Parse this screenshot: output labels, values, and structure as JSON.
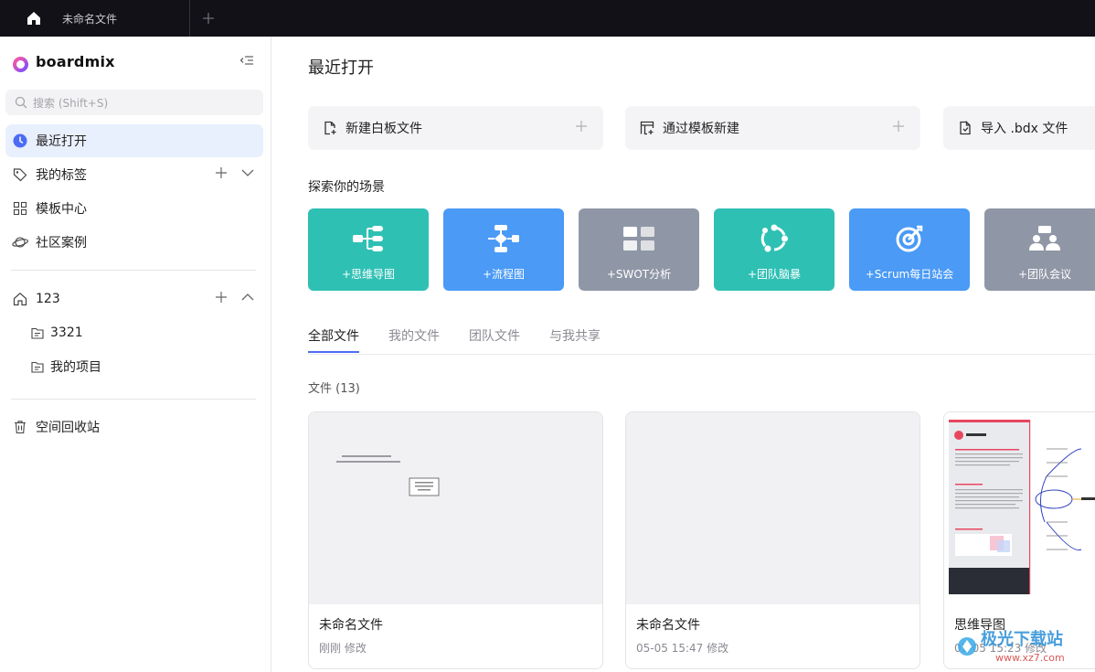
{
  "topbar": {
    "home_icon": "home-icon",
    "doc_tab_label": "未命名文件",
    "new_tab_icon": "plus-icon"
  },
  "sidebar": {
    "brand": "boardmix",
    "search_placeholder": "搜索 (Shift+S)",
    "nav": [
      {
        "label": "最近打开",
        "icon": "clock-icon",
        "active": true
      },
      {
        "label": "我的标签",
        "icon": "tag-icon"
      },
      {
        "label": "模板中心",
        "icon": "grid-icon"
      },
      {
        "label": "社区案例",
        "icon": "planet-icon"
      }
    ],
    "space": {
      "label": "123",
      "icon": "home-outline-icon"
    },
    "folders": [
      {
        "label": "3321",
        "icon": "folder-icon"
      },
      {
        "label": "我的项目",
        "icon": "folder-icon"
      }
    ],
    "trash": {
      "label": "空间回收站",
      "icon": "trash-icon"
    }
  },
  "main": {
    "title": "最近打开",
    "quick_actions": [
      {
        "label": "新建白板文件",
        "icon": "new-file-icon"
      },
      {
        "label": "通过模板新建",
        "icon": "template-icon"
      },
      {
        "label": "导入 .bdx 文件",
        "icon": "import-icon"
      }
    ],
    "scenes_label": "探索你的场景",
    "scenes": [
      {
        "label": "+思维导图",
        "color": "#2fc0b4",
        "icon": "mindmap-icon"
      },
      {
        "label": "+流程图",
        "color": "#4a9af6",
        "icon": "flowchart-icon"
      },
      {
        "label": "+SWOT分析",
        "color": "#8f97a6",
        "icon": "swot-icon"
      },
      {
        "label": "+团队脑暴",
        "color": "#2fc0b4",
        "icon": "brainstorm-icon"
      },
      {
        "label": "+Scrum每日站会",
        "color": "#4a9af6",
        "icon": "target-icon"
      },
      {
        "label": "+团队会议",
        "color": "#8f97a6",
        "icon": "meeting-icon"
      }
    ],
    "tabs": [
      "全部文件",
      "我的文件",
      "团队文件",
      "与我共享"
    ],
    "file_count": "文件 (13)",
    "files": [
      {
        "name": "未命名文件",
        "time": "刚刚 修改"
      },
      {
        "name": "未命名文件",
        "time": "05-05 15:47 修改"
      },
      {
        "name": "思维导图",
        "time": "05-05 15:23 修改"
      }
    ]
  },
  "watermark": {
    "text": "极光下载站",
    "url": "www.xz7.com"
  }
}
